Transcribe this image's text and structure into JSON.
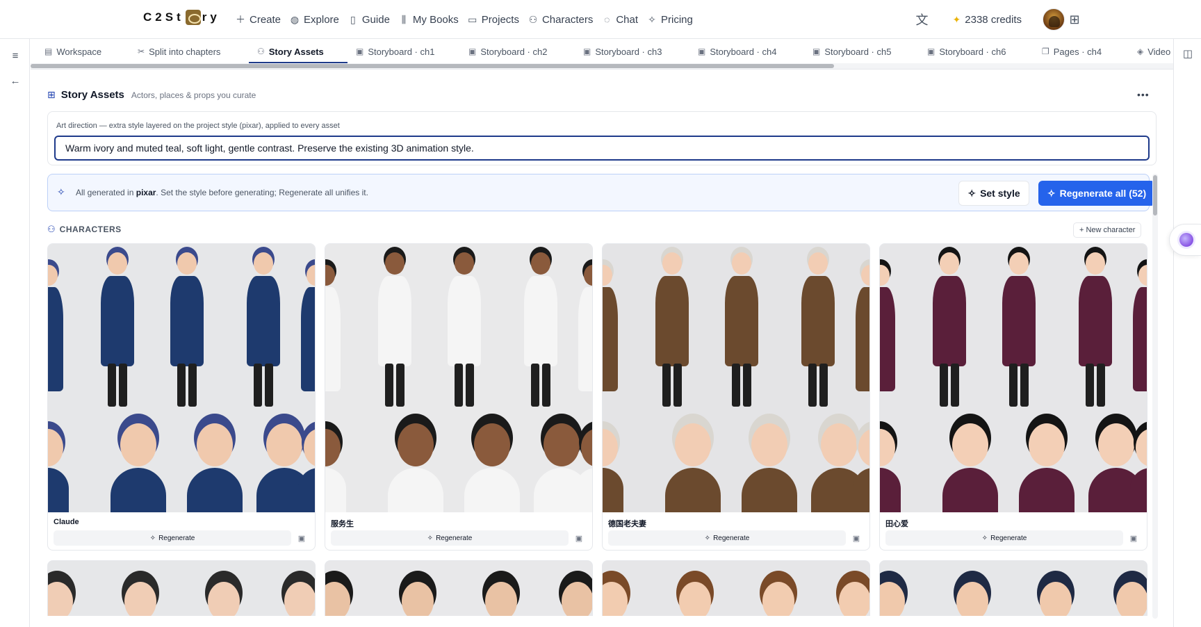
{
  "app": {
    "logo_left": "C2St",
    "logo_right": "ry"
  },
  "nav": {
    "items": [
      {
        "label": "Create",
        "icon": "plus-icon"
      },
      {
        "label": "Explore",
        "icon": "globe-icon"
      },
      {
        "label": "Guide",
        "icon": "book-open-icon"
      },
      {
        "label": "My Books",
        "icon": "library-icon"
      },
      {
        "label": "Projects",
        "icon": "folder-icon"
      },
      {
        "label": "Characters",
        "icon": "users-icon"
      },
      {
        "label": "Chat",
        "icon": "chat-bubble-icon"
      },
      {
        "label": "Pricing",
        "icon": "sparkles-icon"
      }
    ]
  },
  "header": {
    "credits": "2338 credits"
  },
  "tabs": [
    {
      "label": "Workspace",
      "icon": "document-icon"
    },
    {
      "label": "Split into chapters",
      "icon": "scissors-icon"
    },
    {
      "label": "Story Assets",
      "icon": "user-group-icon",
      "active": true
    },
    {
      "label": "Storyboard · ch1",
      "icon": "film-icon"
    },
    {
      "label": "Storyboard · ch2",
      "icon": "film-icon"
    },
    {
      "label": "Storyboard · ch3",
      "icon": "film-icon"
    },
    {
      "label": "Storyboard · ch4",
      "icon": "film-icon"
    },
    {
      "label": "Storyboard · ch5",
      "icon": "film-icon"
    },
    {
      "label": "Storyboard · ch6",
      "icon": "film-icon"
    },
    {
      "label": "Pages · ch4",
      "icon": "pages-icon"
    },
    {
      "label": "Video",
      "icon": "layers-icon"
    }
  ],
  "assets": {
    "title": "Story Assets",
    "subtitle": "Actors, places & props you curate",
    "art_direction_label": "Art direction — extra style layered on the project style (pixar), applied to every asset",
    "art_direction_value": "Warm ivory and muted teal, soft light, gentle contrast. Preserve the existing 3D animation style.",
    "style_note_prefix": "All generated in ",
    "style_note_style": "pixar",
    "style_note_suffix": ". Set the style before generating; Regenerate all unifies it.",
    "set_style_label": "Set style",
    "regenerate_all_label": "Regenerate all (52)",
    "characters_heading": "CHARACTERS",
    "new_character_label": "+ New character",
    "regenerate_label": "Regenerate"
  },
  "characters": [
    {
      "name": "Claude",
      "palette": {
        "skin": "#f0c9ad",
        "hair": "#3b4a8c",
        "outfit": "#1e3a6e",
        "bg": "#e6e7e9"
      }
    },
    {
      "name": "服务生",
      "palette": {
        "skin": "#8a5a3c",
        "hair": "#1a1a1a",
        "outfit": "#f5f5f5",
        "bg": "#e9e9ea"
      }
    },
    {
      "name": "德国老夫妻",
      "palette": {
        "skin": "#f2cdb4",
        "hair": "#d9d6d0",
        "outfit": "#6b4a2e",
        "bg": "#e4e4e6"
      }
    },
    {
      "name": "田心爱",
      "palette": {
        "skin": "#f3cfb6",
        "hair": "#141414",
        "outfit": "#5a1f3a",
        "bg": "#e6e6e8"
      }
    }
  ],
  "characters_row2": [
    {
      "palette": {
        "skin": "#f0cdb5",
        "hair": "#2a2a2a",
        "bg": "#e6e7e9"
      }
    },
    {
      "palette": {
        "skin": "#e9c2a4",
        "hair": "#1a1a1a",
        "bg": "#e8e8ea"
      }
    },
    {
      "palette": {
        "skin": "#f2ccb0",
        "hair": "#7a4a28",
        "bg": "#e6e6e8"
      }
    },
    {
      "palette": {
        "skin": "#f0c9ac",
        "hair": "#1f2a44",
        "bg": "#e6e7e9"
      }
    }
  ]
}
